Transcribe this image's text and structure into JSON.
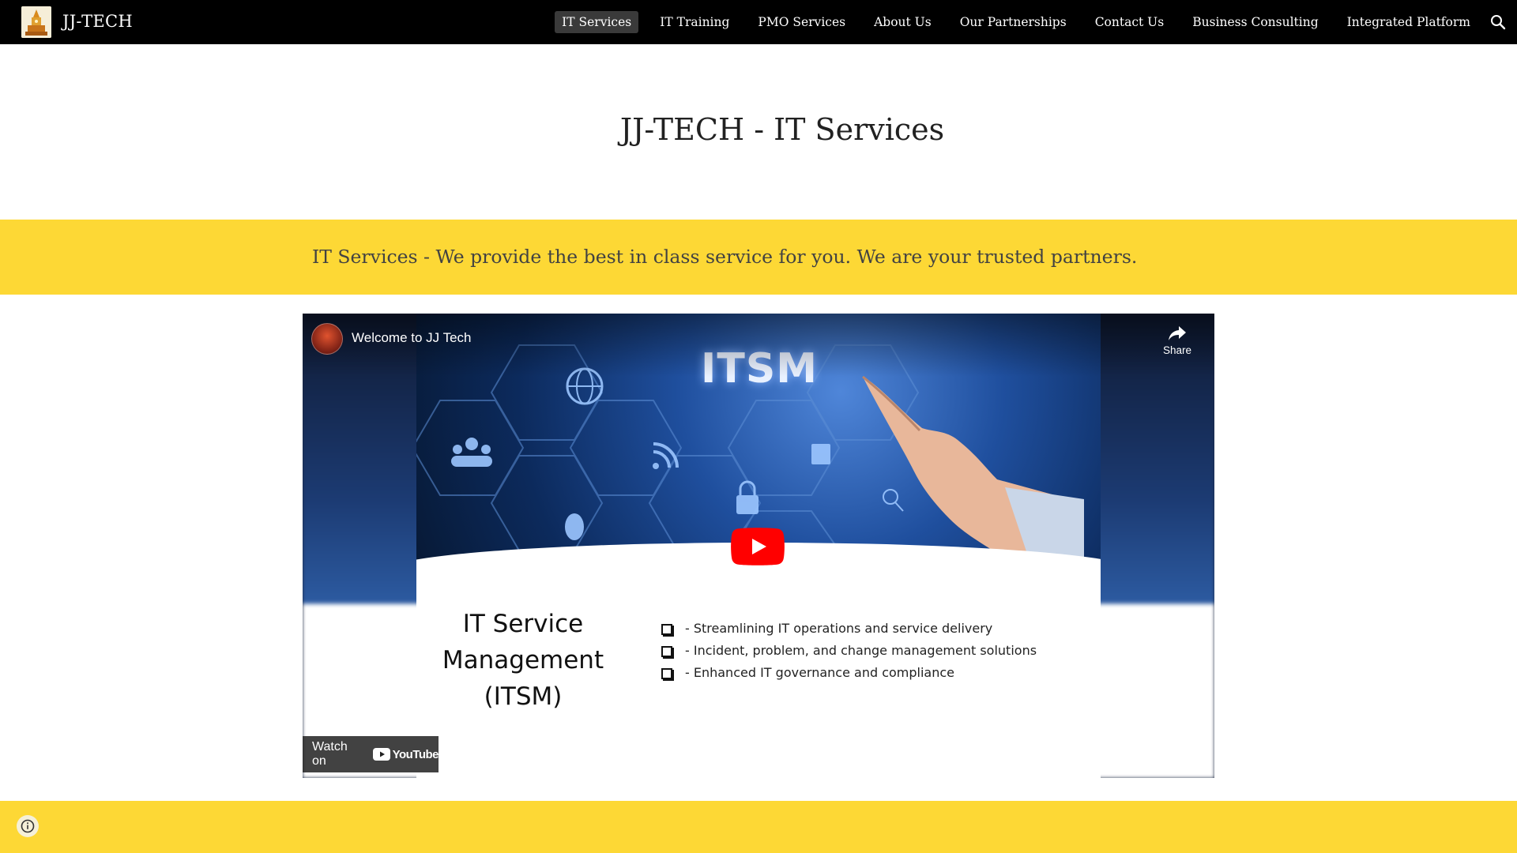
{
  "header": {
    "site_title": "JJ-TECH",
    "nav_items": [
      {
        "label": "IT Services",
        "active": true
      },
      {
        "label": "IT Training",
        "active": false
      },
      {
        "label": "PMO Services",
        "active": false
      },
      {
        "label": "About Us",
        "active": false
      },
      {
        "label": "Our Partnerships",
        "active": false
      },
      {
        "label": "Contact Us",
        "active": false
      },
      {
        "label": "Business Consulting",
        "active": false
      },
      {
        "label": "Integrated Platform",
        "active": false
      }
    ],
    "search_icon": "search-icon"
  },
  "hero": {
    "title": "JJ-TECH  - IT Services"
  },
  "banner": {
    "text": "IT Services - We provide the best in class service for you. We are your trusted partners."
  },
  "video": {
    "title": "Welcome to JJ Tech",
    "share_label": "Share",
    "watch_on_label": "Watch on",
    "youtube_label": "YouTube",
    "slide": {
      "banner_word": "ITSM",
      "heading": "IT Service Management (ITSM)",
      "bullets": [
        "- Streamlining IT operations and service delivery",
        "- Incident, problem, and change management solutions",
        "- Enhanced IT governance and compliance"
      ]
    }
  },
  "colors": {
    "nav_bg": "#000000",
    "banner_bg": "#fdd835",
    "play_red": "#ff0000"
  }
}
